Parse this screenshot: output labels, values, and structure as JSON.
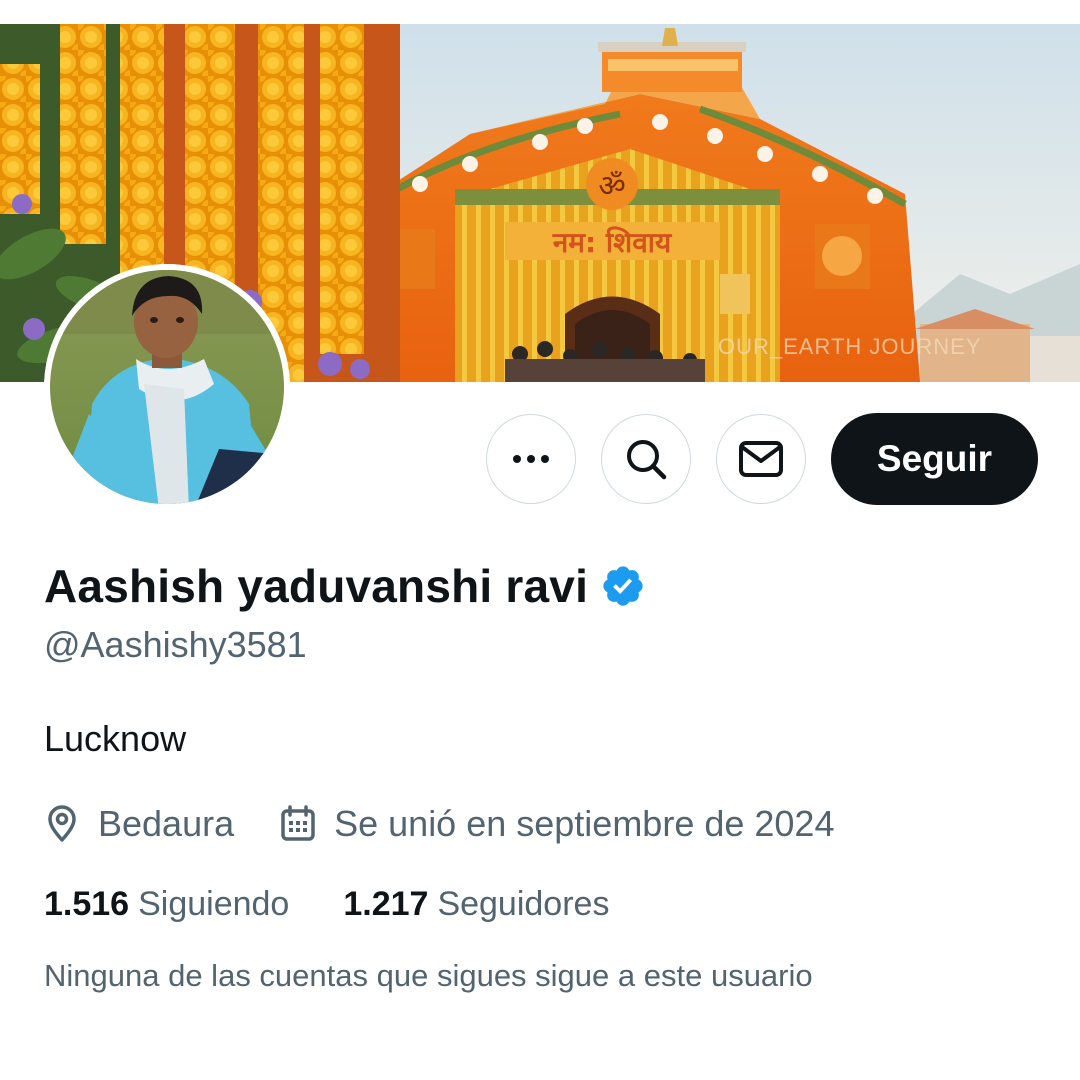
{
  "profile": {
    "display_name": "Aashish yaduvanshi ravi",
    "verified": true,
    "handle": "@Aashishy3581",
    "bio": "Lucknow",
    "location": "Bedaura",
    "joined": "Se unió en septiembre de 2024",
    "following_count": "1.516",
    "following_label": "Siguiendo",
    "followers_count": "1.217",
    "followers_label": "Seguidores",
    "followers_you_know": "Ninguna de las cuentas que sigues sigue a este usuario"
  },
  "banner": {
    "watermark": "OUR_EARTH JOURNEY",
    "sign_text": "नम: शिवाय"
  },
  "actions": {
    "follow_label": "Seguir",
    "more_icon": "more-horizontal-icon",
    "search_icon": "search-icon",
    "message_icon": "envelope-icon"
  },
  "icons": {
    "location": "location-pin-icon",
    "calendar": "calendar-icon",
    "verified": "verified-badge-icon"
  },
  "colors": {
    "text_primary": "#0f1419",
    "text_secondary": "#536471",
    "verified_blue": "#1d9bf0",
    "button_dark": "#0f1419",
    "border": "#cfd9de"
  }
}
